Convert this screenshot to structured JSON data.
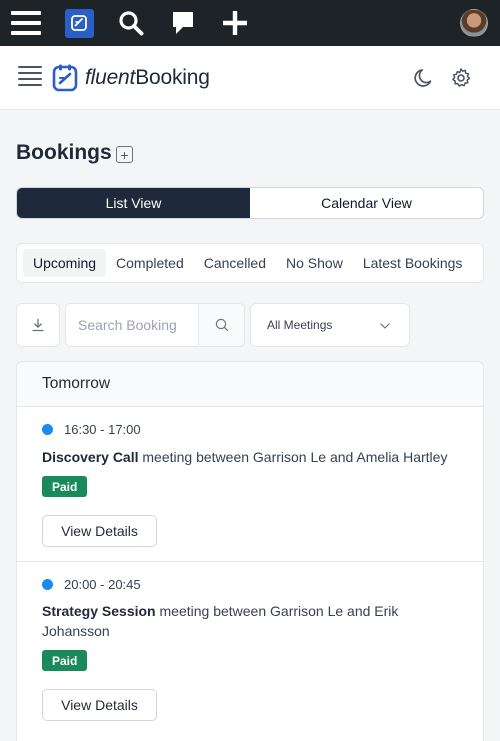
{
  "adminbar": {
    "icons": [
      "menu-icon",
      "app-icon",
      "search-icon",
      "comment-icon",
      "plus-icon",
      "avatar"
    ]
  },
  "header": {
    "logo_part1": "fluent",
    "logo_part2": "Booking",
    "icons": [
      "moon-icon",
      "gear-icon"
    ]
  },
  "page": {
    "title": "Bookings"
  },
  "views": {
    "list": "List View",
    "calendar": "Calendar View",
    "active": "List View"
  },
  "tabs": [
    {
      "label": "Upcoming",
      "active": true
    },
    {
      "label": "Completed"
    },
    {
      "label": "Cancelled"
    },
    {
      "label": "No Show"
    },
    {
      "label": "Latest Bookings"
    }
  ],
  "filters": {
    "search_placeholder": "Search Booking",
    "meetings_select": "All Meetings"
  },
  "group": {
    "label": "Tomorrow"
  },
  "bookings": [
    {
      "time": "16:30 - 17:00",
      "event": "Discovery Call",
      "rest": " meeting between Garrison Le and Amelia Hartley",
      "status": "Paid",
      "action": "View Details"
    },
    {
      "time": "20:00 - 20:45",
      "event": "Strategy Session",
      "rest": " meeting between Garrison Le and Erik Johansson",
      "status": "Paid",
      "action": "View Details"
    }
  ],
  "colors": {
    "adminbar": "#1d2327",
    "active_view": "#1e293b",
    "status_dot": "#1a8bf0",
    "paid_badge": "#1b8a5a",
    "brand_blue": "#2b5ec7"
  }
}
